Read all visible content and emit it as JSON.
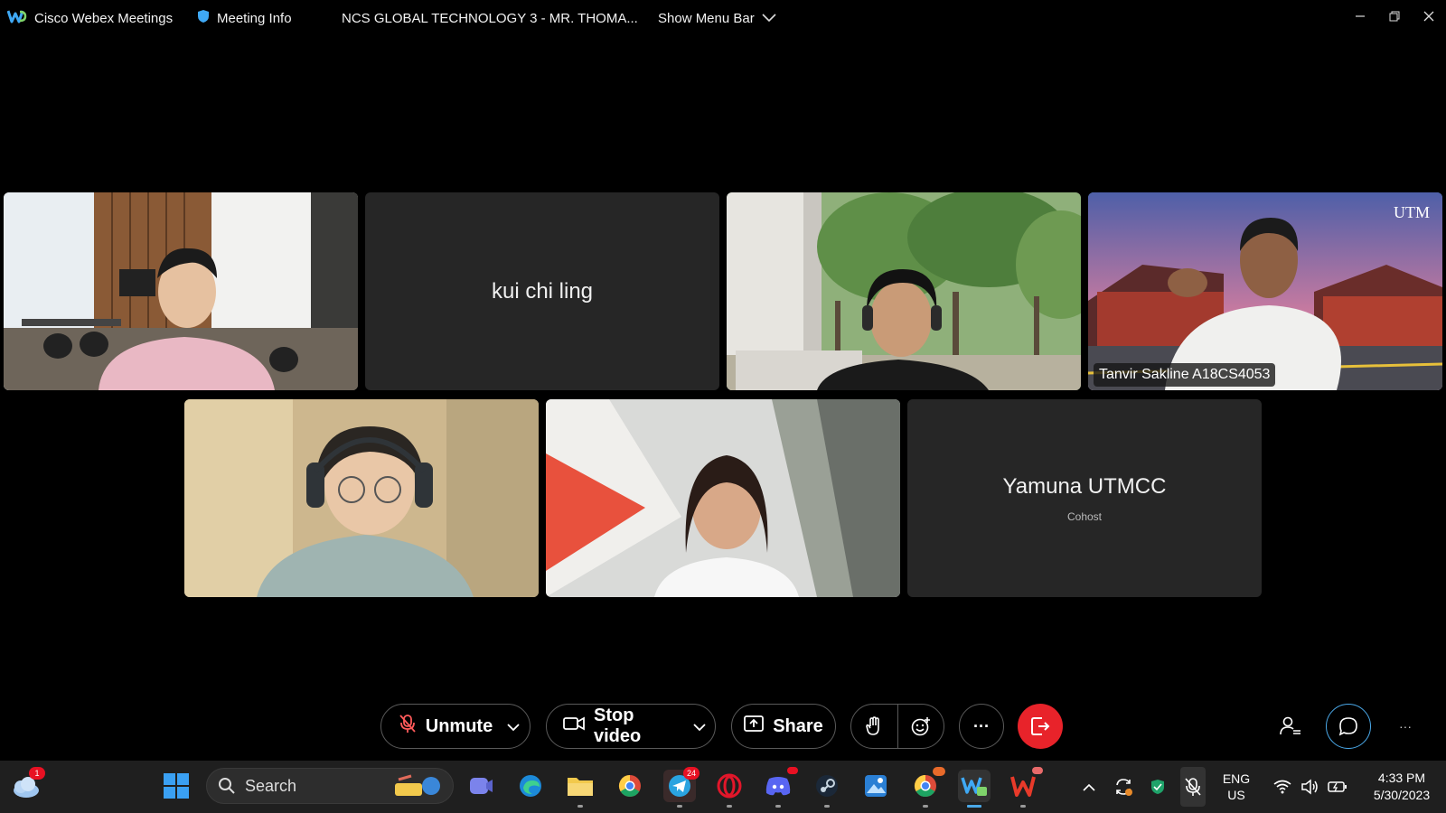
{
  "titlebar": {
    "app_name": "Cisco Webex Meetings",
    "meeting_info": "Meeting Info",
    "meeting_title": "NCS GLOBAL TECHNOLOGY 3 - MR. THOMA...",
    "show_menu_bar": "Show Menu Bar"
  },
  "participants": [
    {
      "name": "",
      "video": true
    },
    {
      "name": "kui chi ling",
      "video": false
    },
    {
      "name": "",
      "video": true
    },
    {
      "name": "Tanvir Sakline A18CS4053",
      "video": true,
      "active_speaker": true,
      "watermark": "UTM"
    },
    {
      "name": "",
      "video": true
    },
    {
      "name": "",
      "video": true
    },
    {
      "name": "Yamuna UTMCC",
      "role": "Cohost",
      "video": false
    }
  ],
  "controls": {
    "unmute": "Unmute",
    "stop_video": "Stop video",
    "share": "Share",
    "more": "···",
    "leave_color": "#e8232a",
    "overflow": "···"
  },
  "taskbar": {
    "search_placeholder": "Search",
    "weather_badge": "1",
    "telegram_badge": "24",
    "language_line1": "ENG",
    "language_line2": "US",
    "time": "4:33 PM",
    "date": "5/30/2023"
  },
  "colors": {
    "accent": "#4aa8e8",
    "tile_bg": "#262626",
    "leave": "#e8232a"
  }
}
